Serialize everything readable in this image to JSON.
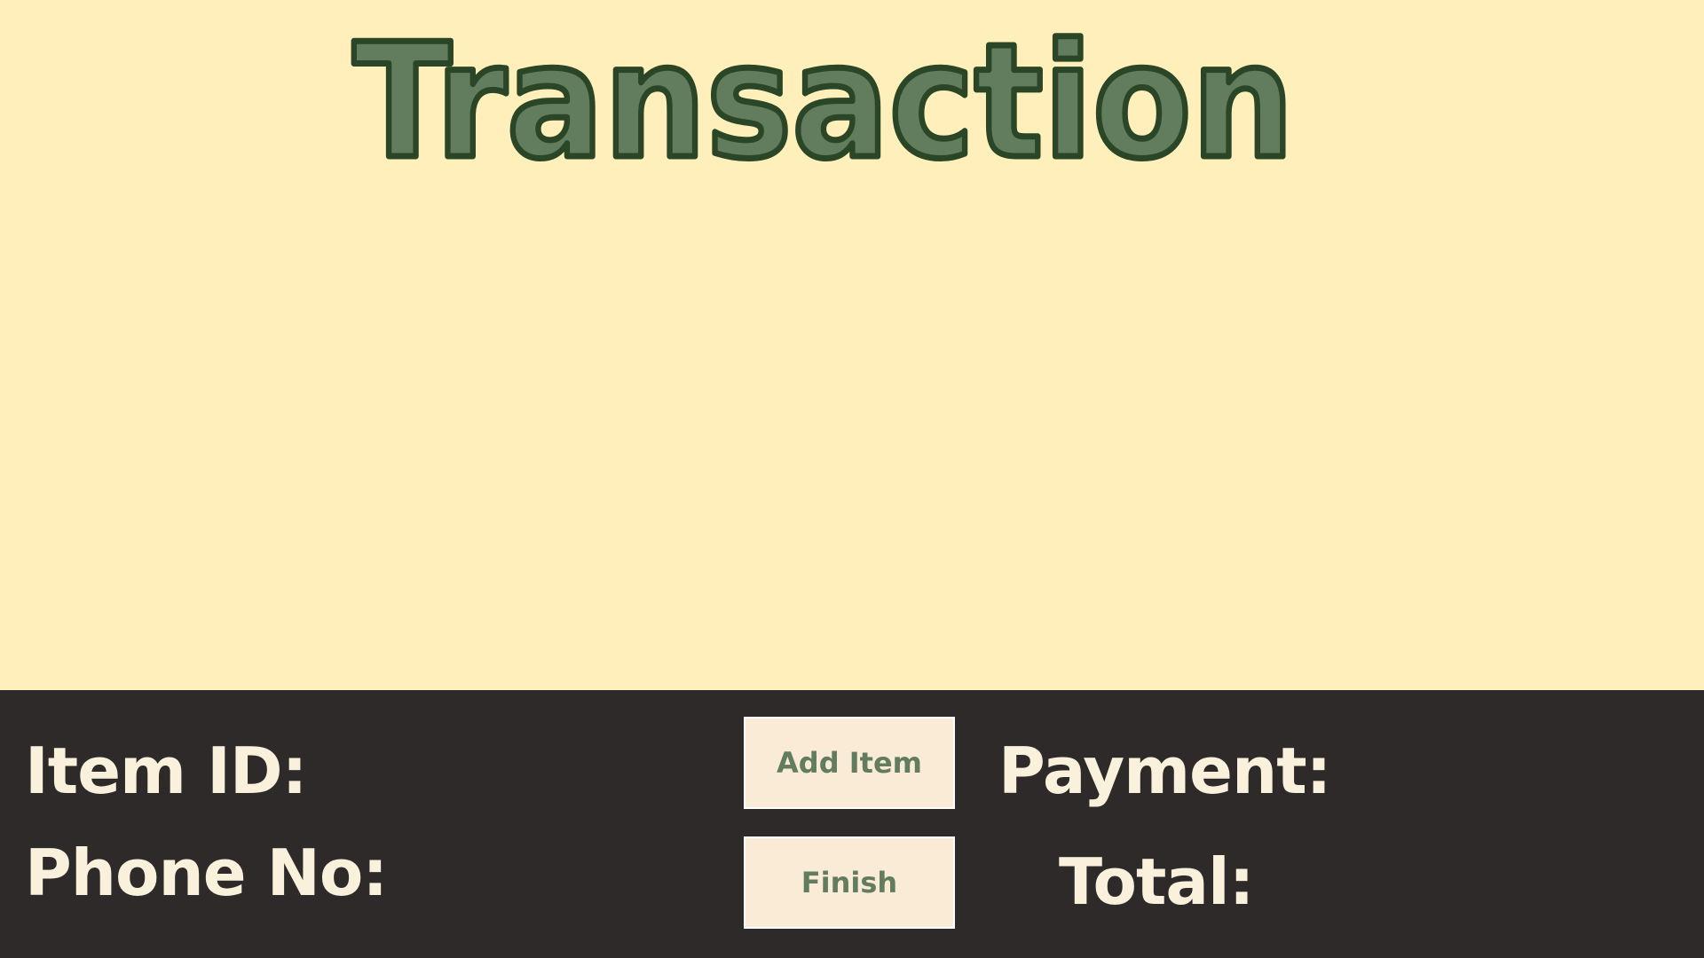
{
  "title": {
    "text": "Transaction"
  },
  "form": {
    "item_id_label": "Item ID:",
    "phone_no_label": "Phone No:",
    "payment_label": "Payment:",
    "total_label": "Total:"
  },
  "buttons": {
    "add_item_label": "Add Item",
    "finish_label": "Finish"
  },
  "colors": {
    "background": "#fff0bb",
    "panel": "#2e2a2a",
    "title_fill": "#627d5e",
    "title_outline": "#2b4626",
    "panel_text": "#faf1dd",
    "button_bg": "#faebd7",
    "button_text": "#627d5e"
  }
}
